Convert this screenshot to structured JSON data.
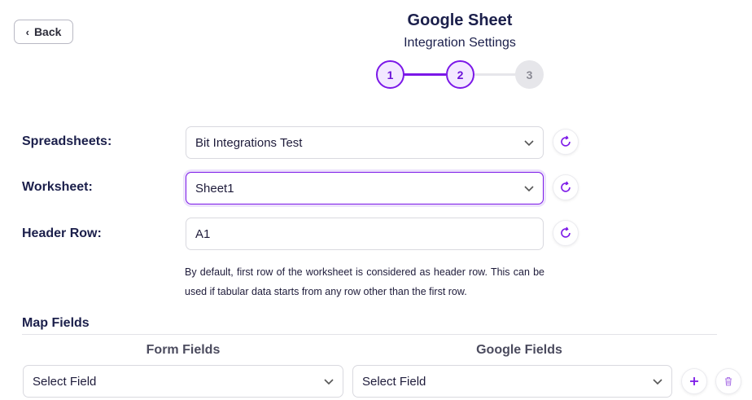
{
  "header": {
    "back_label": "Back",
    "title": "Google Sheet",
    "subtitle": "Integration Settings"
  },
  "stepper": {
    "steps": [
      {
        "label": "1",
        "state": "done"
      },
      {
        "label": "2",
        "state": "current"
      },
      {
        "label": "3",
        "state": "upcoming"
      }
    ]
  },
  "form": {
    "spreadsheets": {
      "label": "Spreadsheets:",
      "value": "Bit Integrations Test"
    },
    "worksheet": {
      "label": "Worksheet:",
      "value": "Sheet1"
    },
    "header_row": {
      "label": "Header Row:",
      "value": "A1"
    },
    "help_text": "By default, first row of the worksheet is considered as header row. This can be used if tabular data starts from any row other than the first row."
  },
  "map_fields": {
    "title": "Map Fields",
    "form_fields_header": "Form Fields",
    "google_fields_header": "Google Fields",
    "row": {
      "form_field": "Select Field",
      "google_field": "Select Field"
    }
  },
  "colors": {
    "accent": "#7b17e8",
    "text": "#1b1f4b",
    "inactive": "#e6e6ea"
  }
}
